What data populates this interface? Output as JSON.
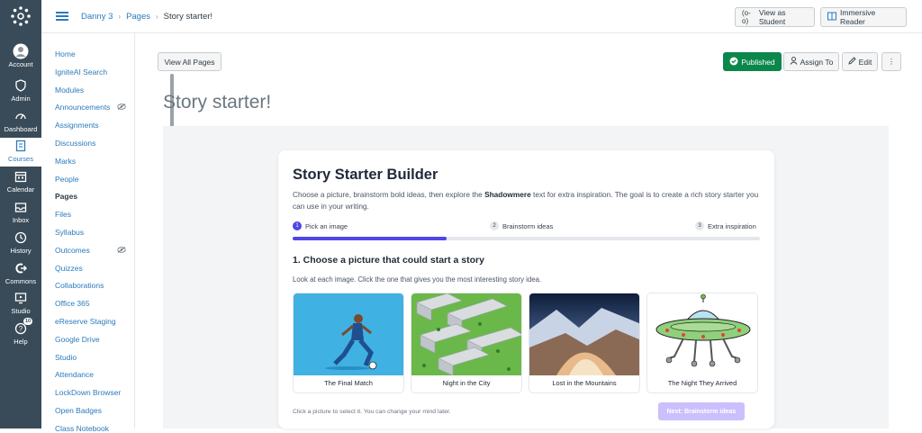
{
  "global_nav": {
    "items": [
      {
        "label": "Account",
        "icon": "account-icon"
      },
      {
        "label": "Admin",
        "icon": "shield-icon"
      },
      {
        "label": "Dashboard",
        "icon": "dashboard-icon"
      },
      {
        "label": "Courses",
        "icon": "book-icon"
      },
      {
        "label": "Calendar",
        "icon": "calendar-icon"
      },
      {
        "label": "Inbox",
        "icon": "inbox-icon"
      },
      {
        "label": "History",
        "icon": "clock-icon"
      },
      {
        "label": "Commons",
        "icon": "commons-icon"
      },
      {
        "label": "Studio",
        "icon": "studio-icon"
      },
      {
        "label": "Help",
        "icon": "help-icon",
        "badge": "10"
      }
    ]
  },
  "breadcrumbs": {
    "course": "Danny 3",
    "section": "Pages",
    "current": "Story starter!"
  },
  "top_buttons": {
    "view_as_student": "View as Student",
    "immersive_reader": "Immersive Reader"
  },
  "course_nav": {
    "items": [
      {
        "label": "Home"
      },
      {
        "label": "IgniteAI Search"
      },
      {
        "label": "Modules"
      },
      {
        "label": "Announcements",
        "hidden": true
      },
      {
        "label": "Assignments"
      },
      {
        "label": "Discussions"
      },
      {
        "label": "Marks"
      },
      {
        "label": "People"
      },
      {
        "label": "Pages",
        "active": true
      },
      {
        "label": "Files"
      },
      {
        "label": "Syllabus"
      },
      {
        "label": "Outcomes",
        "hidden": true
      },
      {
        "label": "Quizzes"
      },
      {
        "label": "Collaborations"
      },
      {
        "label": "Office 365"
      },
      {
        "label": "eReserve Staging"
      },
      {
        "label": "Google Drive"
      },
      {
        "label": "Studio"
      },
      {
        "label": "Attendance"
      },
      {
        "label": "LockDown Browser"
      },
      {
        "label": "Open Badges"
      },
      {
        "label": "Class Notebook"
      }
    ]
  },
  "toolbar": {
    "view_all_pages": "View All Pages",
    "published": "Published",
    "assign_to": "Assign To",
    "edit": "Edit",
    "more": "⋮"
  },
  "page": {
    "title": "Story starter!"
  },
  "builder": {
    "title": "Story Starter Builder",
    "desc_before": "Choose a picture, brainstorm bold ideas, then explore the ",
    "desc_bold": "Shadowmere",
    "desc_after": " text for extra inspiration. The goal is to create a rich story starter you can use in your writing.",
    "steps": [
      {
        "num": "1",
        "label": "Pick an image",
        "active": true
      },
      {
        "num": "2",
        "label": "Brainstorm ideas",
        "active": false
      },
      {
        "num": "3",
        "label": "Extra inspiration",
        "active": false
      }
    ],
    "progress_fraction": 0.33,
    "section_title": "1. Choose a picture that could start a story",
    "section_sub": "Look at each image. Click the one that gives you the most interesting story idea.",
    "pictures": [
      {
        "caption": "The Final Match"
      },
      {
        "caption": "Night in the City"
      },
      {
        "caption": "Lost in the Mountains"
      },
      {
        "caption": "The Night They Arrived"
      }
    ],
    "hint": "Click a picture to select it. You can change your mind later.",
    "next_button": "Next: Brainstorm ideas"
  },
  "colors": {
    "nav_bg": "#394b58",
    "link": "#2b7abc",
    "published": "#0b874b",
    "accent": "#4f46e5"
  }
}
